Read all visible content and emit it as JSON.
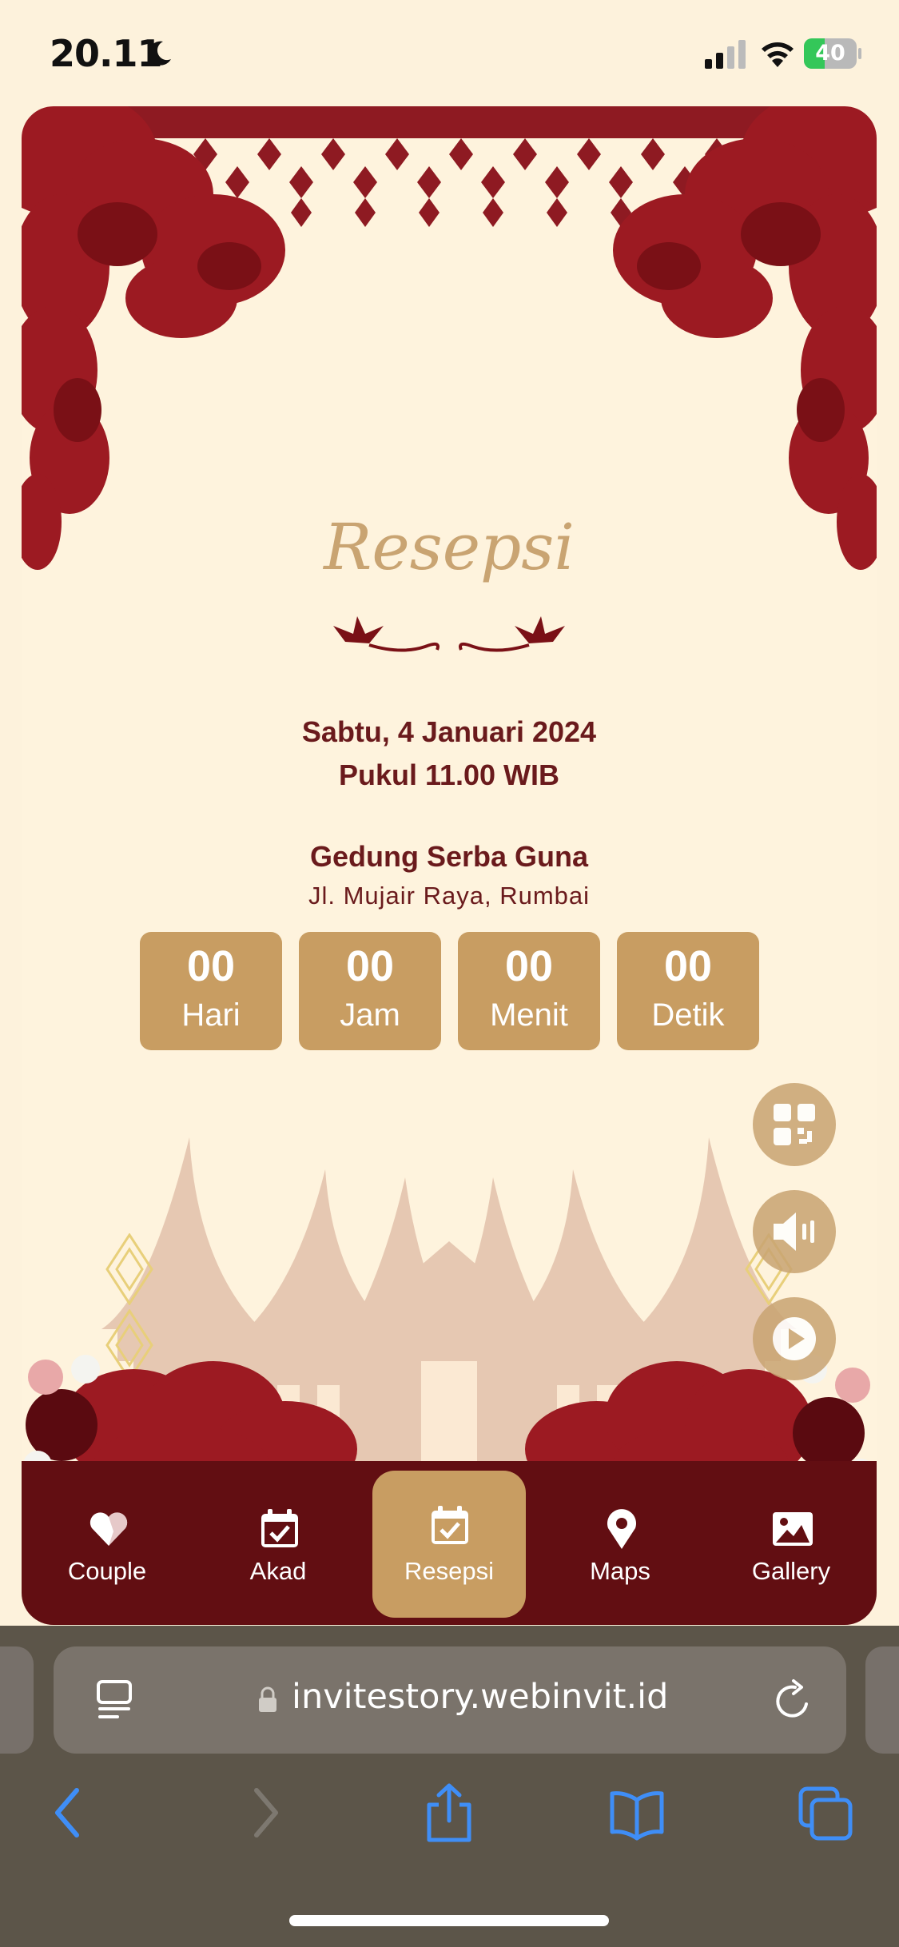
{
  "status_bar": {
    "time": "20.11",
    "battery": "40",
    "battery_level": 0.4
  },
  "invitation": {
    "section_title": "Resepsi",
    "date": "Sabtu, 4 Januari 2024",
    "time": "Pukul 11.00 WIB",
    "venue": "Gedung Serba Guna",
    "address": "Jl. Mujair Raya, Rumbai",
    "countdown": [
      {
        "value": "00",
        "label": "Hari"
      },
      {
        "value": "00",
        "label": "Jam"
      },
      {
        "value": "00",
        "label": "Menit"
      },
      {
        "value": "00",
        "label": "Detik"
      }
    ]
  },
  "floating_actions": [
    "qr-code-icon",
    "speaker-icon",
    "play-icon"
  ],
  "nav": {
    "items": [
      {
        "label": "Couple",
        "icon": "heart-icon"
      },
      {
        "label": "Akad",
        "icon": "calendar-check-icon"
      },
      {
        "label": "Resepsi",
        "icon": "calendar-check-icon",
        "active": true
      },
      {
        "label": "Maps",
        "icon": "map-pin-icon"
      },
      {
        "label": "Gallery",
        "icon": "image-icon"
      }
    ]
  },
  "browser": {
    "url": "invitestory.webinvit.id"
  },
  "colors": {
    "background": "#fef3dd",
    "maroon": "#620e12",
    "gold": "#c89d62",
    "text": "#6a1a1c"
  }
}
